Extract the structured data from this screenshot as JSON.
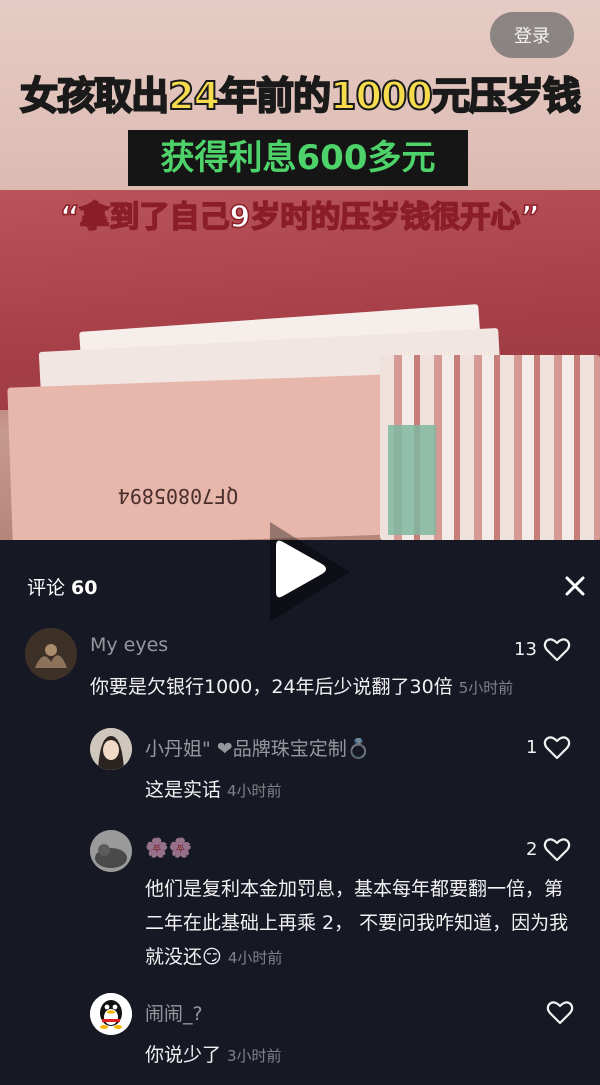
{
  "video": {
    "headline": "女孩取出24年前的1000元压岁钱",
    "subhead": "获得利息600多元",
    "quote": "“拿到了自己9岁时的压岁钱很开心”",
    "serial": "QF70805894",
    "login_label": "登录",
    "play_icon": "play-icon"
  },
  "comments_panel": {
    "title": "评论",
    "count": "60",
    "close_icon": "close-icon"
  },
  "comments": [
    {
      "name": "My eyes",
      "text": "你要是欠银行1000，24年后少说翻了30倍",
      "time": "5小时前",
      "likes": "13",
      "avatar_color": "#5a4a3a"
    },
    {
      "name": "小丹姐\" ❤品牌珠宝定制💍",
      "text": "这是实话",
      "time": "4小时前",
      "likes": "1",
      "avatar_color": "#d8d0c8"
    },
    {
      "name": "🌸🌸",
      "text": "他们是复利本金加罚息，基本每年都要翻一倍，第二年在此基础上再乘 2， 不要问我咋知道，因为我就没还😏",
      "time": "4小时前",
      "likes": "2",
      "avatar_color": "#8a8a8a"
    },
    {
      "name": "闹闹_?",
      "text": "你说少了",
      "time": "3小时前",
      "likes": "",
      "avatar_color": "#ffffff"
    }
  ],
  "colors": {
    "panel_bg": "#161823",
    "headline_yellow": "#f6dc4c",
    "subhead_green": "#4ed36a"
  }
}
